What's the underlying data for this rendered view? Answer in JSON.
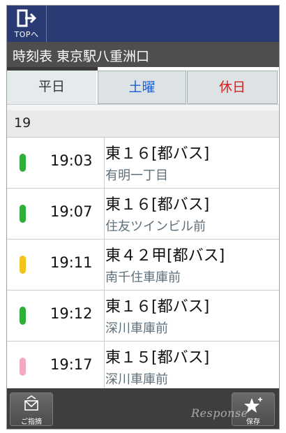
{
  "header": {
    "top_label": "TOPへ"
  },
  "title": "時刻表 東京駅八重洲口",
  "tabs": [
    {
      "label": "平日",
      "color": "#333333"
    },
    {
      "label": "土曜",
      "color": "#1a5fd6"
    },
    {
      "label": "休日",
      "color": "#d62020"
    }
  ],
  "hour": "19",
  "departures": [
    {
      "time": "19:03",
      "route": "東１６[都バス]",
      "destination": "有明一丁目",
      "indicator_color": "#2fae3a"
    },
    {
      "time": "19:07",
      "route": "東１６[都バス]",
      "destination": "住友ツインビル前",
      "indicator_color": "#2fae3a"
    },
    {
      "time": "19:11",
      "route": "東４２甲[都バス]",
      "destination": "南千住車庫前",
      "indicator_color": "#f2c21d"
    },
    {
      "time": "19:12",
      "route": "東１６[都バス]",
      "destination": "深川車庫前",
      "indicator_color": "#2fae3a"
    },
    {
      "time": "19:17",
      "route": "東１５[都バス]",
      "destination": "深川車庫前",
      "indicator_color": "#f2a9c3"
    }
  ],
  "bottom": {
    "left_label": "ご指摘",
    "right_label": "保存"
  },
  "watermark": "Response"
}
